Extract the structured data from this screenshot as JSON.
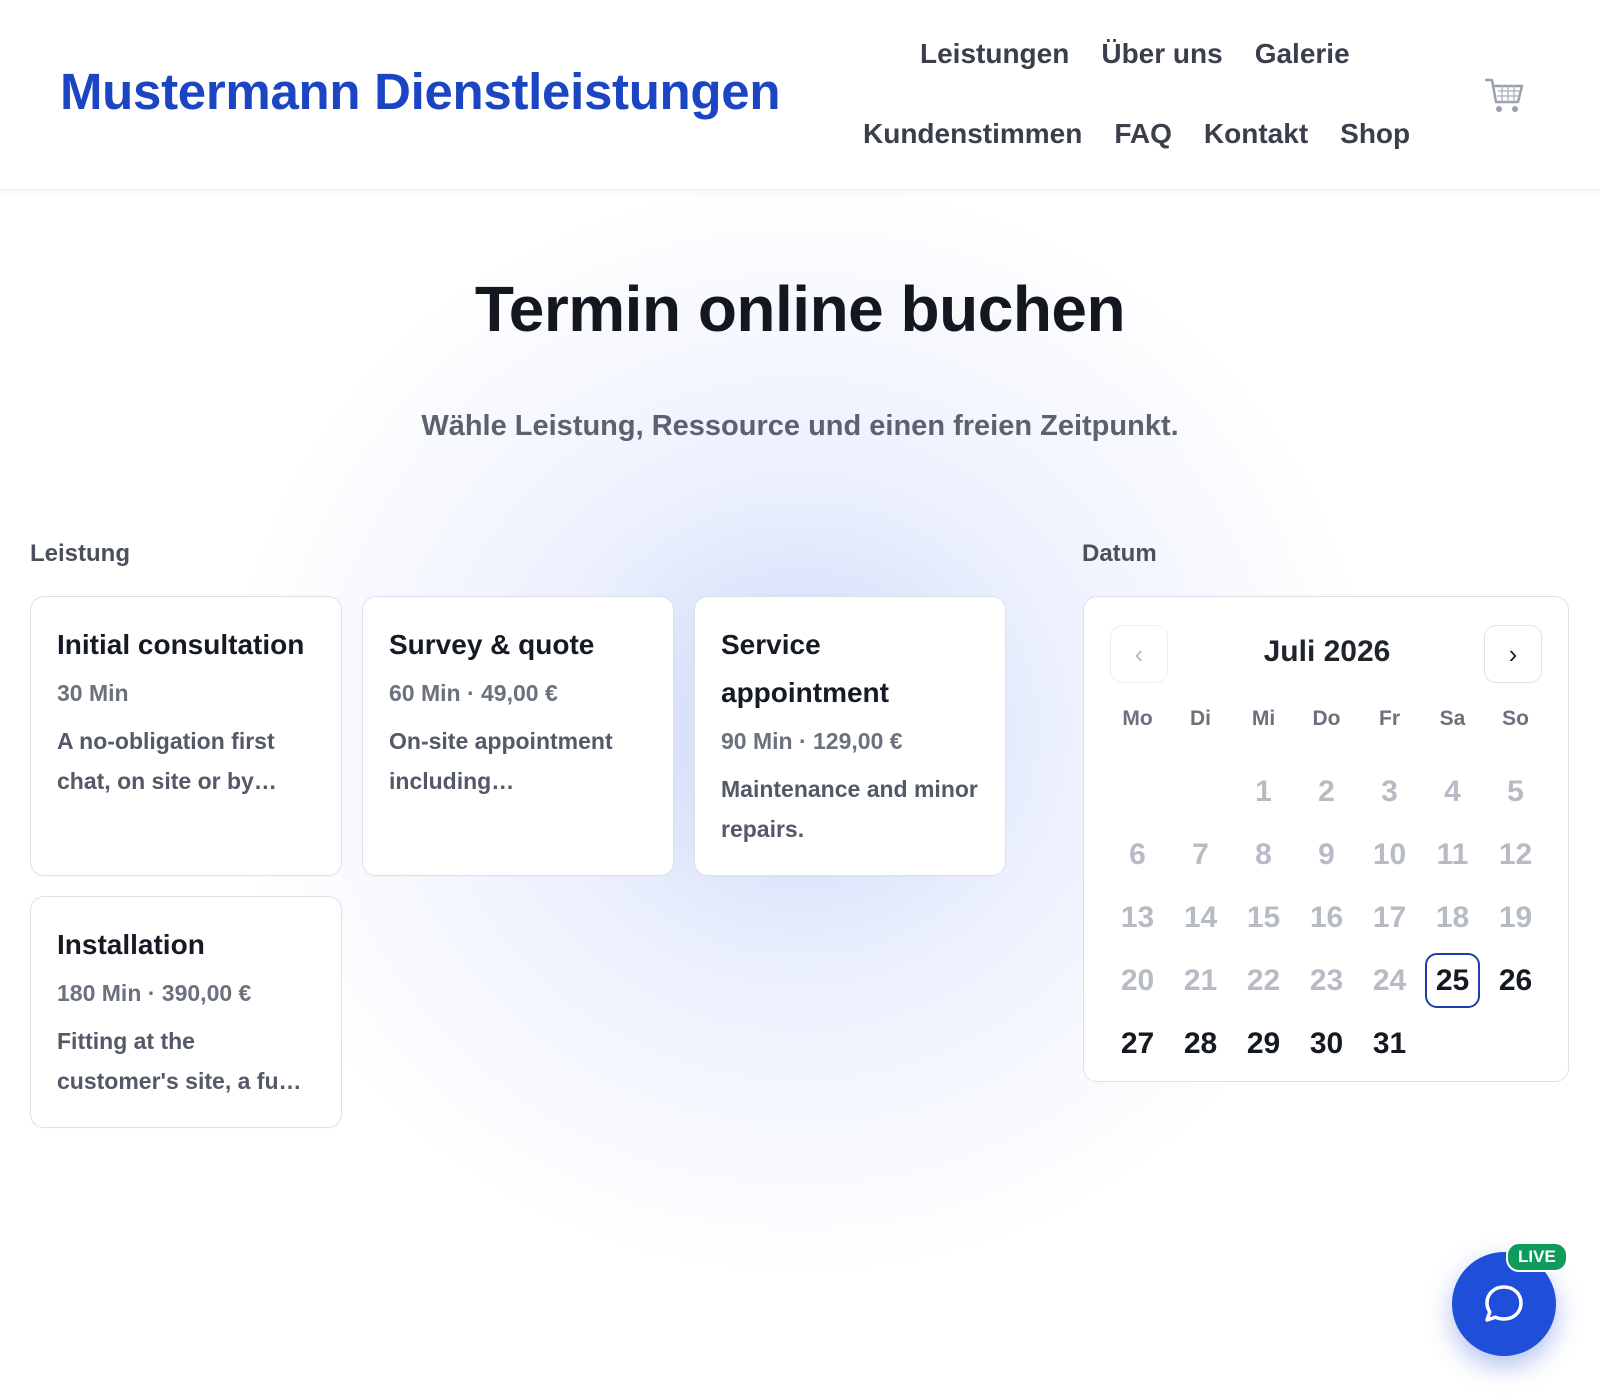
{
  "header": {
    "brand": "Mustermann Dienstleistungen",
    "nav_row1": [
      "Leistungen",
      "Über uns",
      "Galerie"
    ],
    "nav_row2": [
      "Kundenstimmen",
      "FAQ",
      "Kontakt",
      "Shop"
    ],
    "cart_icon": "cart-icon"
  },
  "hero": {
    "title": "Termin online buchen",
    "subtitle": "Wähle Leistung, Ressource und einen freien Zeitpunkt."
  },
  "services": {
    "label": "Leistung",
    "items": [
      {
        "title": "Initial consultation",
        "meta": "30 Min",
        "desc": "A no-obligation first chat, on site or by…"
      },
      {
        "title": "Survey & quote",
        "meta": "60 Min · 49,00 €",
        "desc": "On-site appointment including…"
      },
      {
        "title": "Service appointment",
        "meta": "90 Min · 129,00 €",
        "desc": "Maintenance and minor repairs."
      },
      {
        "title": "Installation",
        "meta": "180 Min · 390,00 €",
        "desc": "Fitting at the customer's site, a fu…"
      }
    ]
  },
  "calendar": {
    "label": "Datum",
    "month": "Juli 2026",
    "prev_symbol": "‹",
    "next_symbol": "›",
    "weekdays": [
      "Mo",
      "Di",
      "Mi",
      "Do",
      "Fr",
      "Sa",
      "So"
    ],
    "leading_blanks": 2,
    "days_in_month": 31,
    "past_until": 24,
    "selected_day": 25
  },
  "chat": {
    "badge": "LIVE",
    "icon": "chat-bubble-icon"
  },
  "colors": {
    "brand": "#1b45c3",
    "chat": "#1f4ed8",
    "live": "#0f9b5b",
    "selected_border": "#1e3fa8"
  }
}
